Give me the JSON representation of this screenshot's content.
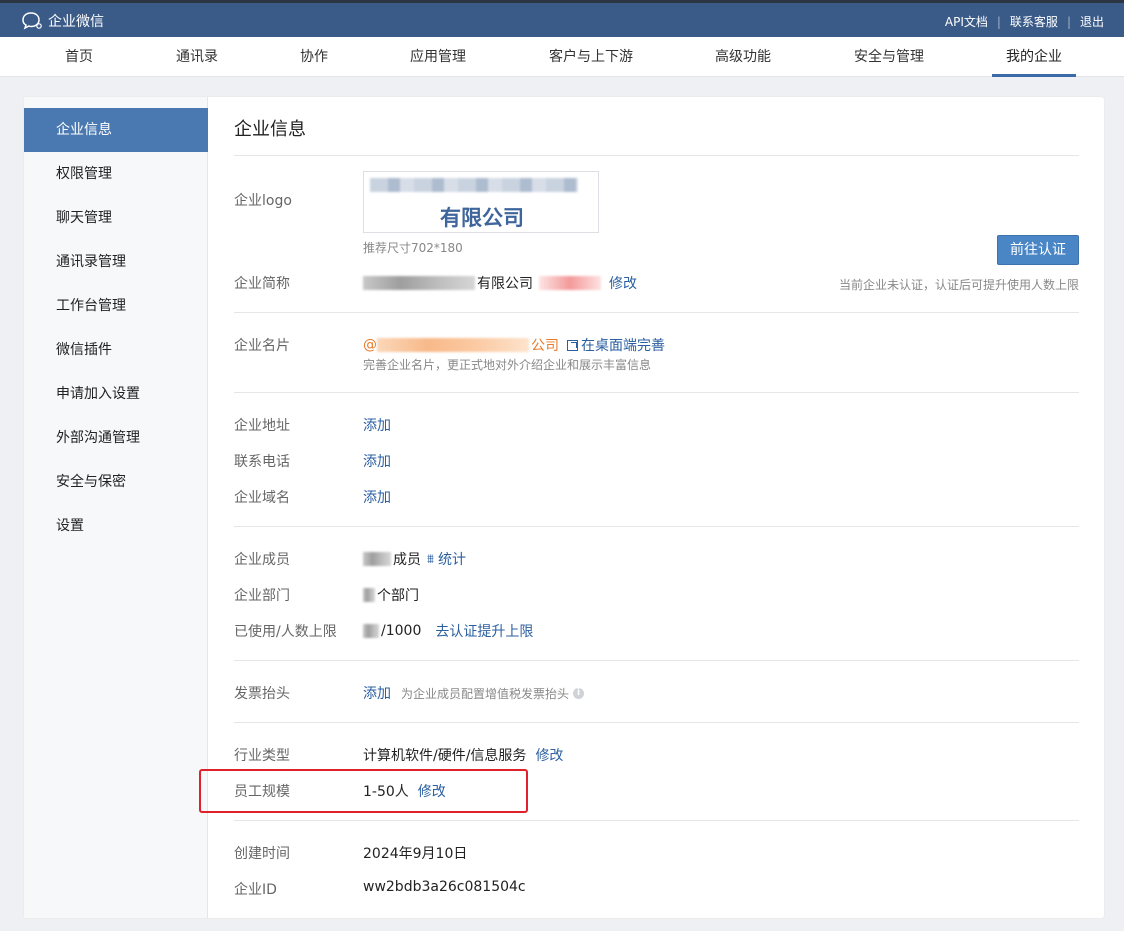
{
  "topbar": {
    "brand": "企业微信",
    "links": [
      "API文档",
      "联系客服",
      "退出"
    ],
    "separator": "|"
  },
  "nav": {
    "items": [
      "首页",
      "通讯录",
      "协作",
      "应用管理",
      "客户与上下游",
      "高级功能",
      "安全与管理",
      "我的企业"
    ],
    "active_index": 7
  },
  "sidebar": {
    "items": [
      "企业信息",
      "权限管理",
      "聊天管理",
      "通讯录管理",
      "工作台管理",
      "微信插件",
      "申请加入设置",
      "外部沟通管理",
      "安全与保密",
      "设置"
    ],
    "active_index": 0
  },
  "content": {
    "title": "企业信息",
    "logo": {
      "label": "企业logo",
      "text": "有限公司",
      "size_hint": "推荐尺寸702*180"
    },
    "verify_button": "前往认证",
    "verify_hint": "当前企业未认证，认证后可提升使用人数上限",
    "short_name": {
      "label": "企业简称",
      "value_suffix": "有限公司",
      "action": "修改"
    },
    "card": {
      "label": "企业名片",
      "prefix": "@",
      "value_suffix": "公司",
      "action": "在桌面端完善",
      "hint": "完善企业名片，更正式地对外介绍企业和展示丰富信息"
    },
    "address": {
      "label": "企业地址",
      "action": "添加"
    },
    "phone": {
      "label": "联系电话",
      "action": "添加"
    },
    "domain": {
      "label": "企业域名",
      "action": "添加"
    },
    "members": {
      "label": "企业成员",
      "value_suffix": "成员",
      "action": "统计"
    },
    "departments": {
      "label": "企业部门",
      "value_suffix": "个部门"
    },
    "usage": {
      "label": "已使用/人数上限",
      "value_suffix": "/1000",
      "action": "去认证提升上限"
    },
    "invoice": {
      "label": "发票抬头",
      "action": "添加",
      "hint": "为企业成员配置增值税发票抬头"
    },
    "industry": {
      "label": "行业类型",
      "value": "计算机软件/硬件/信息服务",
      "action": "修改"
    },
    "scale": {
      "label": "员工规模",
      "value": "1-50人",
      "action": "修改"
    },
    "created": {
      "label": "创建时间",
      "value": "2024年9月10日"
    },
    "corp_id": {
      "label": "企业ID",
      "value": "ww2bdb3a26c081504c"
    }
  },
  "colors": {
    "topbar": "#3a5a88",
    "accent": "#4a78b0",
    "link": "#2b5fa0",
    "highlight": "#e0202a",
    "card_prefix": "#e87a2c"
  }
}
